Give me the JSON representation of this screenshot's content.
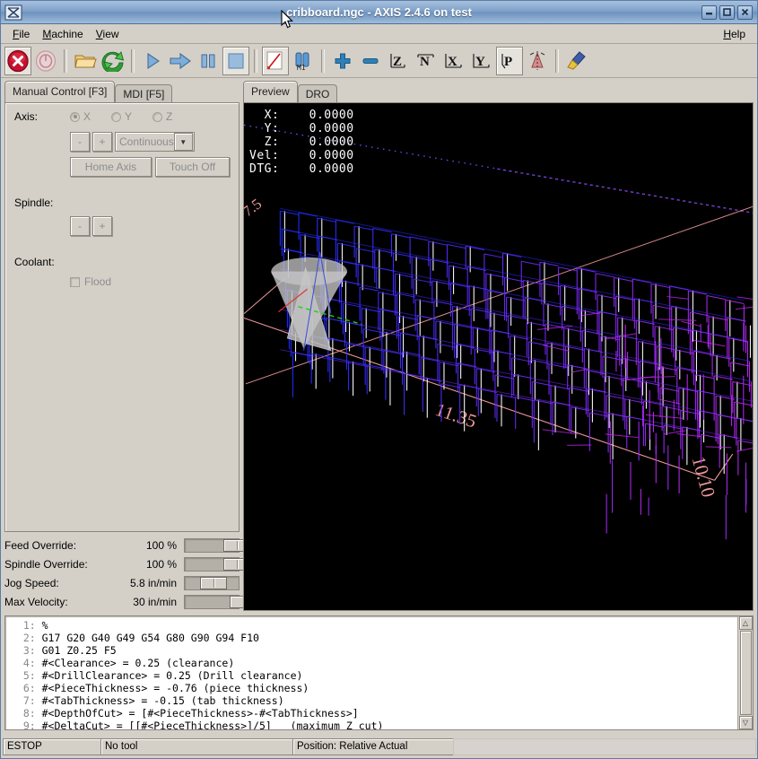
{
  "window": {
    "title": "cribboard.ngc - AXIS 2.4.6 on test",
    "icon": "app-icon",
    "minimize": "–",
    "maximize": "□",
    "close": "✕"
  },
  "menu": {
    "items": [
      {
        "label": "File",
        "accel": "F"
      },
      {
        "label": "Machine",
        "accel": "M"
      },
      {
        "label": "View",
        "accel": "V"
      }
    ],
    "help": {
      "label": "Help",
      "accel": "H"
    }
  },
  "toolbar": {
    "buttons": [
      {
        "name": "estop-toggle-button",
        "title": "Toggle Emergency Stop",
        "pressed": true
      },
      {
        "name": "machine-power-button",
        "title": "Toggle Machine Power",
        "pressed": false
      },
      {
        "name": "open-file-button",
        "title": "Open G-Code file"
      },
      {
        "name": "reload-file-button",
        "title": "Reload G-Code file"
      },
      {
        "name": "run-program-button",
        "title": "Begin executing current file"
      },
      {
        "name": "step-program-button",
        "title": "Execute next line"
      },
      {
        "name": "pause-program-button",
        "title": "Pause execution"
      },
      {
        "name": "stop-program-button",
        "title": "Stop program execution"
      },
      {
        "name": "block-delete-button",
        "title": "Toggle skip lines with '/'",
        "pressed": true
      },
      {
        "name": "optional-stop-button",
        "title": "Toggle optional pause at M1"
      },
      {
        "name": "zoom-in-button",
        "title": "Zoom in"
      },
      {
        "name": "zoom-out-button",
        "title": "Zoom out"
      },
      {
        "name": "view-z-button",
        "title": "Top view"
      },
      {
        "name": "view-z2-button",
        "title": "Rotated top view"
      },
      {
        "name": "view-x-button",
        "title": "Side view"
      },
      {
        "name": "view-y-button",
        "title": "Front view"
      },
      {
        "name": "view-p-button",
        "title": "Perspective view",
        "pressed": true
      },
      {
        "name": "tool-touch-button",
        "title": "Display inches/mm"
      },
      {
        "name": "clear-plot-button",
        "title": "Clear live plot"
      }
    ]
  },
  "left_tabs": [
    {
      "label": "Manual Control [F3]",
      "active": true
    },
    {
      "label": "MDI [F5]",
      "active": false
    }
  ],
  "manual": {
    "axis_label": "Axis:",
    "axes": [
      {
        "label": "X",
        "selected": true
      },
      {
        "label": "Y",
        "selected": false
      },
      {
        "label": "Z",
        "selected": false
      }
    ],
    "jog_minus": "-",
    "jog_plus": "+",
    "jog_mode": "Continuous",
    "home_axis": "Home Axis",
    "touch_off": "Touch Off",
    "spindle_label": "Spindle:",
    "spindle_minus": "-",
    "spindle_plus": "+",
    "coolant_label": "Coolant:",
    "flood_label": "Flood"
  },
  "sliders": [
    {
      "name": "Feed Override:",
      "value": "100 %",
      "pos": 72
    },
    {
      "name": "Spindle Override:",
      "value": "100 %",
      "pos": 72
    },
    {
      "name": "Jog Speed:",
      "value": "5.8 in/min",
      "pos": 28
    },
    {
      "name": "Max Velocity:",
      "value": "30 in/min",
      "pos": 83
    }
  ],
  "right_tabs": [
    {
      "label": "Preview",
      "active": true
    },
    {
      "label": "DRO",
      "active": false
    }
  ],
  "dro": {
    "rows": [
      {
        "label": "X:",
        "value": "0.0000"
      },
      {
        "label": "Y:",
        "value": "0.0000"
      },
      {
        "label": "Z:",
        "value": "0.0000"
      },
      {
        "label": "Vel:",
        "value": "0.0000"
      },
      {
        "label": "DTG:",
        "value": "0.0000"
      }
    ],
    "text": "  X:    0.0000\n  Y:    0.0000\n  Z:    0.0000\nVel:    0.0000\nDTG:    0.0000"
  },
  "preview": {
    "dimension_x": "11.35",
    "dimension_y": "10.10",
    "dimension_small": "7.5",
    "colors": {
      "background": "#000000",
      "feed_near": "#1e2eff",
      "feed_far": "#c028f0",
      "traverse": "#ffffff",
      "extents": "#f09a9a",
      "tool_cone": "#c9c9c9",
      "axis_x": "#ff2020",
      "axis_y": "#20ff20"
    }
  },
  "gcode": {
    "lines": [
      {
        "num": "1:",
        "text": "%"
      },
      {
        "num": "2:",
        "text": "G17 G20 G40 G49 G54 G80 G90 G94 F10"
      },
      {
        "num": "3:",
        "text": "G01 Z0.25 F5"
      },
      {
        "num": "4:",
        "text": "#<Clearance> = 0.25 (clearance)"
      },
      {
        "num": "5:",
        "text": "#<DrillClearance> = 0.25 (Drill clearance)"
      },
      {
        "num": "6:",
        "text": "#<PieceThickness> = -0.76 (piece thickness)"
      },
      {
        "num": "7:",
        "text": "#<TabThickness> = -0.15 (tab thickness)"
      },
      {
        "num": "8:",
        "text": "#<DepthOfCut> = [#<PieceThickness>-#<TabThickness>]"
      },
      {
        "num": "9:",
        "text": "#<DeltaCut> = [[#<PieceThickness>]/5]   (maximum Z cut)"
      }
    ],
    "scroll_up": "△",
    "scroll_down": "▽"
  },
  "status": {
    "machine_state": "ESTOP",
    "tool": "No tool",
    "position": "Position: Relative Actual"
  }
}
